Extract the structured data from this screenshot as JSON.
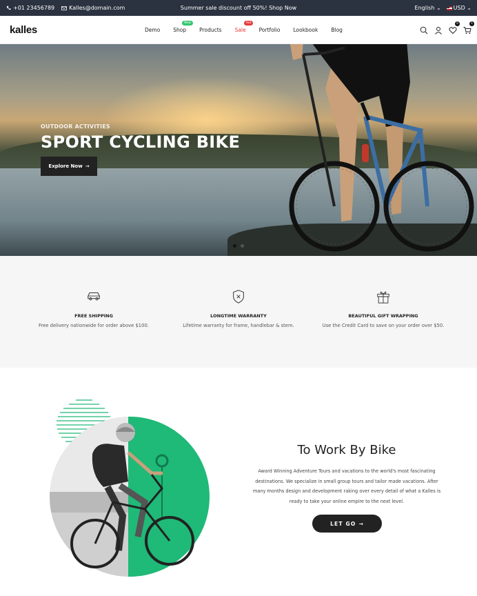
{
  "topbar": {
    "phone": "+01 23456789",
    "email": "Kalles@domain.com",
    "promo": "Summer sale discount off 50%! Shop Now",
    "language": "English",
    "currency": "USD"
  },
  "header": {
    "logo": "kalles",
    "nav": [
      {
        "label": "Demo"
      },
      {
        "label": "Shop",
        "badge": "New"
      },
      {
        "label": "Products"
      },
      {
        "label": "Sale",
        "badge": "Hot"
      },
      {
        "label": "Portfolio"
      },
      {
        "label": "Lookbook"
      },
      {
        "label": "Blog"
      }
    ],
    "wishlist_count": "0",
    "cart_count": "1"
  },
  "hero": {
    "kicker": "OUTDOOR ACTIVITIES",
    "title": "SPORT CYCLING BIKE",
    "cta": "Explore Now"
  },
  "features": [
    {
      "icon": "car-icon",
      "title": "FREE SHIPPING",
      "desc": "Free delivery nationwide for order above $100."
    },
    {
      "icon": "shield-icon",
      "title": "LONGTIME WARRANTY",
      "desc": "Lifetime warranty for frame, handlebar & stem."
    },
    {
      "icon": "gift-icon",
      "title": "BEAUTIFUL GIFT WRAPPING",
      "desc": "Use the Credit Card to save on your order over $50."
    }
  ],
  "about": {
    "title": "To Work By Bike",
    "text": "Award Winning Adventure Tours and vacations to the world's most fascinating destinations. We specialize in small group tours and tailor made vacations. After many months design and development raking over every detail of what a Kalles is ready to take your online empire to the next level.",
    "cta": "LET GO"
  },
  "colors": {
    "accent": "#1fb978",
    "topbar": "#2b3340",
    "sale": "#e53b3b"
  }
}
